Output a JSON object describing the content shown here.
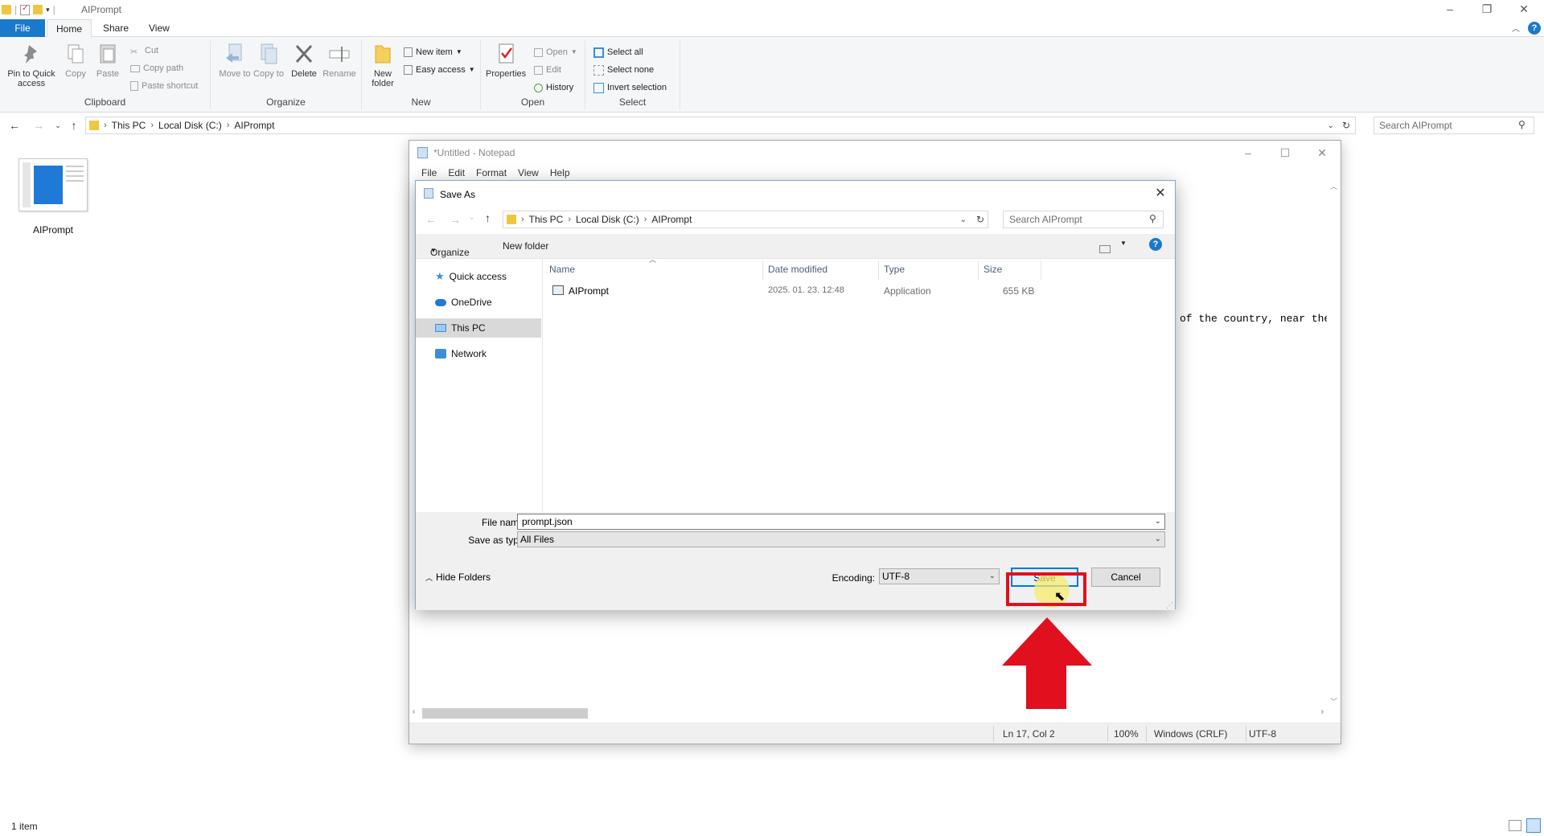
{
  "explorer": {
    "title": "AIPrompt",
    "tabs": {
      "file": "File",
      "home": "Home",
      "share": "Share",
      "view": "View"
    },
    "ribbon": {
      "clipboard": {
        "label": "Clipboard",
        "pin": "Pin to Quick access",
        "copy": "Copy",
        "paste": "Paste",
        "cut": "Cut",
        "copy_path": "Copy path",
        "paste_shortcut": "Paste shortcut"
      },
      "organize": {
        "label": "Organize",
        "move_to": "Move to",
        "copy_to": "Copy to",
        "delete": "Delete",
        "rename": "Rename"
      },
      "new": {
        "label": "New",
        "new_folder": "New folder",
        "new_item": "New item",
        "easy_access": "Easy access"
      },
      "open": {
        "label": "Open",
        "properties": "Properties",
        "open": "Open",
        "edit": "Edit",
        "history": "History"
      },
      "select": {
        "label": "Select",
        "select_all": "Select all",
        "select_none": "Select none",
        "invert": "Invert selection"
      }
    },
    "breadcrumb": [
      "This PC",
      "Local Disk (C:)",
      "AIPrompt"
    ],
    "search_placeholder": "Search AIPrompt",
    "items": [
      {
        "name": "AIPrompt"
      }
    ],
    "status": "1 item"
  },
  "notepad": {
    "title": "*Untitled - Notepad",
    "menu": [
      "File",
      "Edit",
      "Format",
      "View",
      "Help"
    ],
    "visible_text": "of the country, near the",
    "status": {
      "position": "Ln 17, Col 2",
      "zoom": "100%",
      "line_ending": "Windows (CRLF)",
      "encoding": "UTF-8"
    }
  },
  "save_dialog": {
    "title": "Save As",
    "breadcrumb": [
      "This PC",
      "Local Disk (C:)",
      "AIPrompt"
    ],
    "search_placeholder": "Search AIPrompt",
    "toolbar": {
      "organize": "Organize",
      "new_folder": "New folder"
    },
    "nav": [
      "Quick access",
      "OneDrive",
      "This PC",
      "Network"
    ],
    "columns": {
      "name": "Name",
      "date": "Date modified",
      "type": "Type",
      "size": "Size"
    },
    "files": [
      {
        "name": "AIPrompt",
        "date": "2025. 01. 23. 12:48",
        "type": "Application",
        "size": "655 KB"
      }
    ],
    "file_name_label": "File name:",
    "file_name_value": "prompt.json",
    "type_label": "Save as type:",
    "type_value": "All Files",
    "hide_folders": "Hide Folders",
    "encoding_label": "Encoding:",
    "encoding_value": "UTF-8",
    "save": "Save",
    "cancel": "Cancel"
  },
  "colors": {
    "accent": "#1979ca",
    "highlight_box": "#e0101e",
    "arrow": "#e0101e"
  }
}
